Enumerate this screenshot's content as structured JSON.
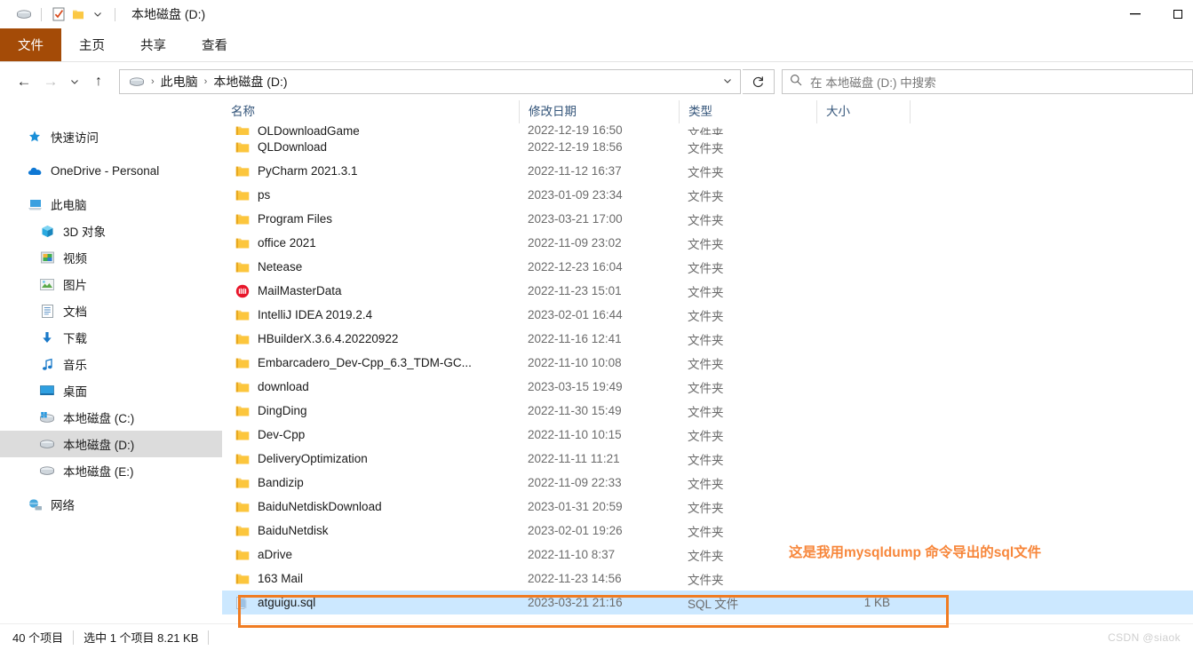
{
  "window": {
    "title": "本地磁盘 (D:)",
    "quick_access": [
      {
        "name": "drive-icon",
        "glyph": "drive"
      },
      {
        "name": "properties-icon",
        "glyph": "checkbox"
      },
      {
        "name": "new-folder-icon",
        "glyph": "folder"
      },
      {
        "name": "customize-qat-chevron-icon",
        "glyph": "▾"
      }
    ],
    "controls": {
      "minimize": "—",
      "maximize": "▢"
    }
  },
  "ribbon": {
    "tabs": [
      {
        "label": "文件",
        "active": true
      },
      {
        "label": "主页",
        "active": false
      },
      {
        "label": "共享",
        "active": false
      },
      {
        "label": "查看",
        "active": false
      }
    ],
    "file_tab_color": "#a44b07"
  },
  "address": {
    "back": "←",
    "forward": "→",
    "recent": "⌄",
    "up": "↑",
    "breadcrumb": [
      "此电脑",
      "本地磁盘 (D:)"
    ],
    "dropdown_caret": "⌄",
    "refresh": "↻"
  },
  "search": {
    "placeholder": "在 本地磁盘 (D:) 中搜索",
    "icon": "search-icon"
  },
  "sidebar": {
    "items": [
      {
        "label": "快速访问",
        "icon": "pin-star-icon",
        "level": 0,
        "selected": false,
        "gap_after": true
      },
      {
        "label": "OneDrive - Personal",
        "icon": "onedrive-cloud-icon",
        "level": 0,
        "selected": false,
        "gap_after": true
      },
      {
        "label": "此电脑",
        "icon": "this-pc-icon",
        "level": 0,
        "selected": false,
        "gap_after": false
      },
      {
        "label": "3D 对象",
        "icon": "3d-objects-icon",
        "level": 1,
        "selected": false,
        "gap_after": false
      },
      {
        "label": "视频",
        "icon": "videos-icon",
        "level": 1,
        "selected": false,
        "gap_after": false
      },
      {
        "label": "图片",
        "icon": "pictures-icon",
        "level": 1,
        "selected": false,
        "gap_after": false
      },
      {
        "label": "文档",
        "icon": "documents-icon",
        "level": 1,
        "selected": false,
        "gap_after": false
      },
      {
        "label": "下载",
        "icon": "downloads-icon",
        "level": 1,
        "selected": false,
        "gap_after": false
      },
      {
        "label": "音乐",
        "icon": "music-icon",
        "level": 1,
        "selected": false,
        "gap_after": false
      },
      {
        "label": "桌面",
        "icon": "desktop-icon",
        "level": 1,
        "selected": false,
        "gap_after": false
      },
      {
        "label": "本地磁盘 (C:)",
        "icon": "windows-drive-icon",
        "level": 1,
        "selected": false,
        "gap_after": false
      },
      {
        "label": "本地磁盘 (D:)",
        "icon": "drive-icon",
        "level": 1,
        "selected": true,
        "gap_after": false
      },
      {
        "label": "本地磁盘 (E:)",
        "icon": "drive-icon",
        "level": 1,
        "selected": false,
        "gap_after": true
      },
      {
        "label": "网络",
        "icon": "network-icon",
        "level": 0,
        "selected": false,
        "gap_after": false
      }
    ]
  },
  "filelist": {
    "columns": [
      {
        "label": "名称",
        "key": "name"
      },
      {
        "label": "修改日期",
        "key": "date"
      },
      {
        "label": "类型",
        "key": "type"
      },
      {
        "label": "大小",
        "key": "size"
      }
    ],
    "sort_indicator": "⌄",
    "rows": [
      {
        "name": "QLDownloadGame",
        "date": "2022-12-19 16:50",
        "type": "文件夹",
        "size": "",
        "icon": "folder-icon",
        "selected": false,
        "clipped": true
      },
      {
        "name": "QLDownload",
        "date": "2022-12-19 18:56",
        "type": "文件夹",
        "size": "",
        "icon": "folder-icon",
        "selected": false
      },
      {
        "name": "PyCharm 2021.3.1",
        "date": "2022-11-12 16:37",
        "type": "文件夹",
        "size": "",
        "icon": "folder-icon",
        "selected": false
      },
      {
        "name": "ps",
        "date": "2023-01-09 23:34",
        "type": "文件夹",
        "size": "",
        "icon": "folder-icon",
        "selected": false
      },
      {
        "name": "Program Files",
        "date": "2023-03-21 17:00",
        "type": "文件夹",
        "size": "",
        "icon": "folder-icon",
        "selected": false
      },
      {
        "name": "office 2021",
        "date": "2022-11-09 23:02",
        "type": "文件夹",
        "size": "",
        "icon": "folder-icon",
        "selected": false
      },
      {
        "name": "Netease",
        "date": "2022-12-23 16:04",
        "type": "文件夹",
        "size": "",
        "icon": "folder-icon",
        "selected": false
      },
      {
        "name": "MailMasterData",
        "date": "2022-11-23 15:01",
        "type": "文件夹",
        "size": "",
        "icon": "mailmaster-icon",
        "selected": false
      },
      {
        "name": "IntelliJ IDEA 2019.2.4",
        "date": "2023-02-01 16:44",
        "type": "文件夹",
        "size": "",
        "icon": "folder-icon",
        "selected": false
      },
      {
        "name": "HBuilderX.3.6.4.20220922",
        "date": "2022-11-16 12:41",
        "type": "文件夹",
        "size": "",
        "icon": "folder-icon",
        "selected": false
      },
      {
        "name": "Embarcadero_Dev-Cpp_6.3_TDM-GC...",
        "date": "2022-11-10 10:08",
        "type": "文件夹",
        "size": "",
        "icon": "folder-icon",
        "selected": false
      },
      {
        "name": "download",
        "date": "2023-03-15 19:49",
        "type": "文件夹",
        "size": "",
        "icon": "folder-icon",
        "selected": false
      },
      {
        "name": "DingDing",
        "date": "2022-11-30 15:49",
        "type": "文件夹",
        "size": "",
        "icon": "folder-icon",
        "selected": false
      },
      {
        "name": "Dev-Cpp",
        "date": "2022-11-10 10:15",
        "type": "文件夹",
        "size": "",
        "icon": "folder-icon",
        "selected": false
      },
      {
        "name": "DeliveryOptimization",
        "date": "2022-11-11 11:21",
        "type": "文件夹",
        "size": "",
        "icon": "folder-icon",
        "selected": false
      },
      {
        "name": "Bandizip",
        "date": "2022-11-09 22:33",
        "type": "文件夹",
        "size": "",
        "icon": "folder-icon",
        "selected": false
      },
      {
        "name": "BaiduNetdiskDownload",
        "date": "2023-01-31 20:59",
        "type": "文件夹",
        "size": "",
        "icon": "folder-icon",
        "selected": false
      },
      {
        "name": "BaiduNetdisk",
        "date": "2023-02-01 19:26",
        "type": "文件夹",
        "size": "",
        "icon": "folder-icon",
        "selected": false
      },
      {
        "name": "aDrive",
        "date": "2022-11-10 8:37",
        "type": "文件夹",
        "size": "",
        "icon": "folder-icon",
        "selected": false
      },
      {
        "name": "163 Mail",
        "date": "2022-11-23 14:56",
        "type": "文件夹",
        "size": "",
        "icon": "folder-icon",
        "selected": false
      },
      {
        "name": "atguigu.sql",
        "date": "2023-03-21 21:16",
        "type": "SQL 文件",
        "size": "1 KB",
        "icon": "sql-file-icon",
        "selected": true
      }
    ]
  },
  "annotation": {
    "text": "这是我用mysqldump 命令导出的sql文件",
    "color": "#f7863a",
    "box_color": "#f07c22"
  },
  "statusbar": {
    "item_count": "40 个项目",
    "selection": "选中 1 个项目  8.21 KB"
  },
  "watermark": {
    "text": "CSDN @siaok"
  }
}
